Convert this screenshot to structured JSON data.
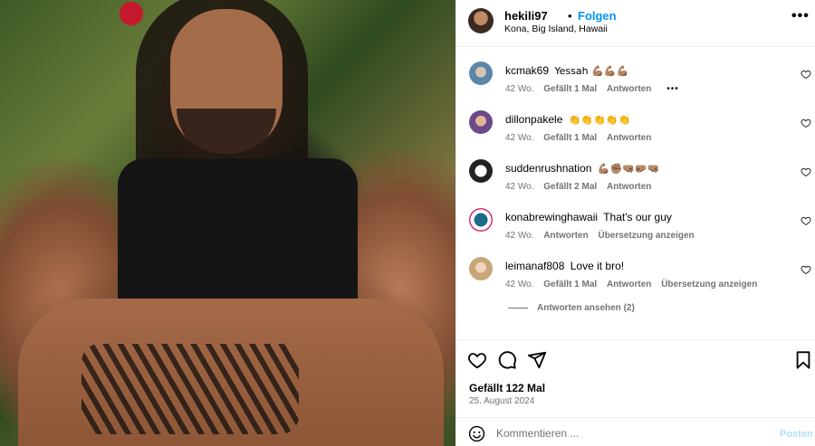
{
  "header": {
    "username": "hekili97",
    "separator": "•",
    "follow_label": "Folgen",
    "location": "Kona, Big Island, Hawaii",
    "more_icon": "more-horizontal-icon"
  },
  "comments": [
    {
      "username": "kcmak69",
      "text": "Yessah 💪🏽💪🏽💪🏽",
      "age": "42 Wo.",
      "likes": "Gefällt 1 Mal",
      "reply": "Antworten",
      "more": "•••",
      "avatar_color": "#9fb7c9"
    },
    {
      "username": "dillonpakele",
      "text": "👏👏👏👏👏",
      "age": "42 Wo.",
      "likes": "Gefällt 1 Mal",
      "reply": "Antworten",
      "avatar_color": "#6b4a8a"
    },
    {
      "username": "suddenrushnation",
      "text": "💪🏽✊🏽🤜🏽🤛🏽🤜🏽",
      "age": "42 Wo.",
      "likes": "Gefällt 2 Mal",
      "reply": "Antworten",
      "avatar_color": "#222222"
    },
    {
      "username": "konabrewinghawaii",
      "text": "That's our guy",
      "age": "42 Wo.",
      "reply": "Antworten",
      "translate": "Übersetzung anzeigen",
      "avatar_color": "#1d6b8a"
    },
    {
      "username": "leimanaf808",
      "text": "Love it bro!",
      "age": "42 Wo.",
      "likes": "Gefällt 1 Mal",
      "reply": "Antworten",
      "translate": "Übersetzung anzeigen",
      "avatar_color": "#c9a57a"
    }
  ],
  "view_replies": "Antworten ansehen (2)",
  "actions": {
    "like_icon": "heart-icon",
    "comment_icon": "comment-icon",
    "share_icon": "send-icon",
    "save_icon": "bookmark-icon"
  },
  "likes_count": "Gefällt 122 Mal",
  "post_date": "25. August 2024",
  "composer": {
    "placeholder": "Kommentieren ...",
    "post_label": "Posten",
    "post_color": "#b2dffc"
  },
  "colors": {
    "accent": "#0095f6",
    "muted": "#737373",
    "divider": "#efefef"
  }
}
